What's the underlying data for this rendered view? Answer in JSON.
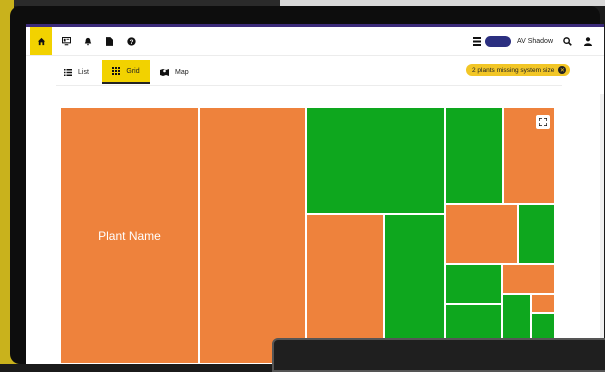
{
  "navbar": {
    "home_icon": "home-icon",
    "icons": [
      "dashboard-icon",
      "bell-icon",
      "document-icon",
      "help-icon"
    ],
    "right": {
      "list_icon": "list-view-icon",
      "toggle_label": "AV Shadow",
      "search_icon": "search-icon",
      "user_icon": "user-icon"
    }
  },
  "tabs": {
    "list_label": "List",
    "grid_label": "Grid",
    "map_label": "Map",
    "active": "Grid"
  },
  "notice": {
    "text": "2 plants missing system size"
  },
  "treemap": {
    "first_label": "Plant Name",
    "colors": {
      "orange": "#ee823c",
      "green": "#0ea71e"
    }
  },
  "colors": {
    "accent": "#f2d200",
    "toggle": "#2b2f80",
    "pill": "#f2c626"
  }
}
